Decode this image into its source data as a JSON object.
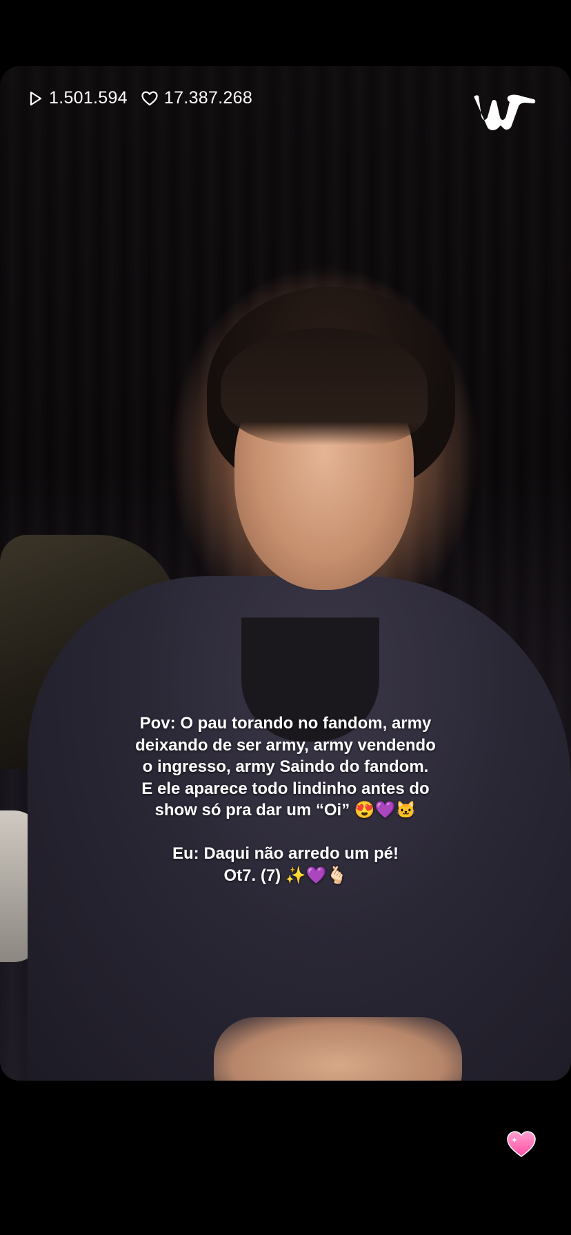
{
  "stats": {
    "plays": "1.501.594",
    "likes": "17.387.268",
    "play_icon": "play-outline-icon",
    "like_icon": "heart-outline-icon"
  },
  "brand": {
    "logo_icon": "weverse-logo-icon"
  },
  "caption": {
    "lines": [
      "Pov: O pau torando no fandom, army",
      "deixando de ser army, army vendendo",
      "o ingresso, army Saindo do fandom.",
      "E ele aparece todo lindinho antes do",
      "show só pra dar um “Oi” 😍💜🐱",
      "",
      "Eu: Daqui não arredo um pé!",
      "Ot7. (7) ✨💜🫰🏻"
    ]
  },
  "actions": {
    "heart_button_icon": "sparkle-heart-icon",
    "heart_color": "#ff6fb5"
  }
}
